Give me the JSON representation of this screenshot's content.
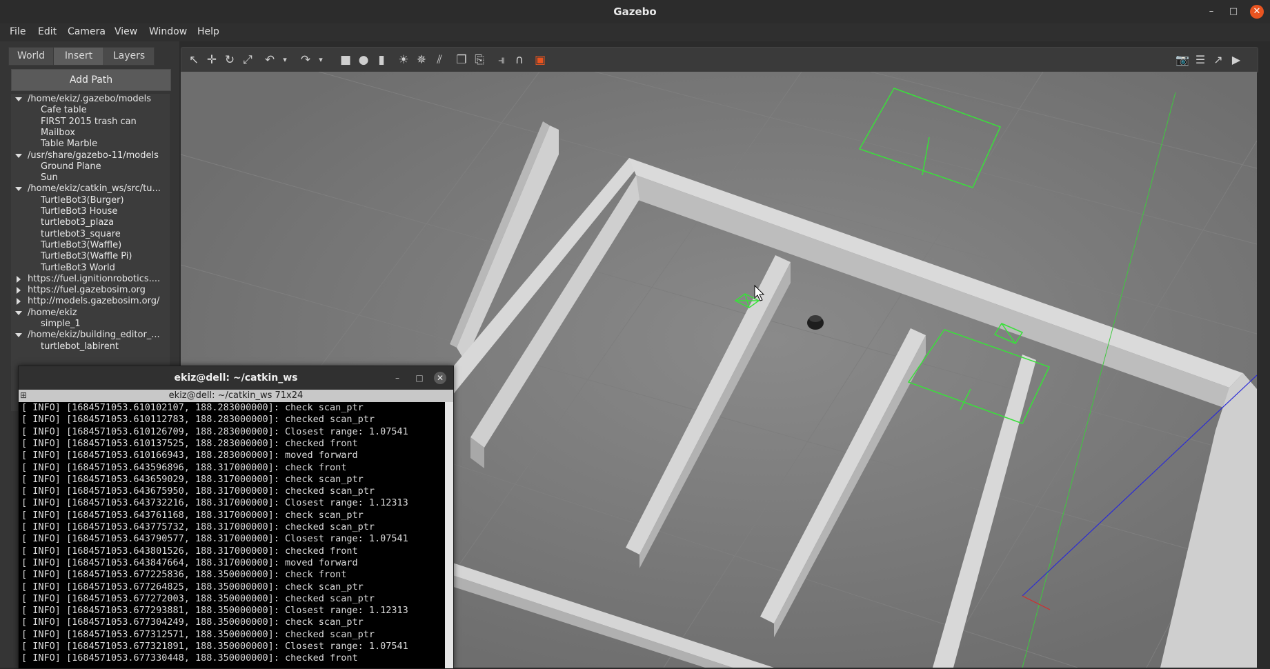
{
  "window": {
    "title": "Gazebo"
  },
  "menu": [
    "File",
    "Edit",
    "Camera",
    "View",
    "Window",
    "Help"
  ],
  "tabs": [
    "World",
    "Insert",
    "Layers"
  ],
  "insert": {
    "add_path_label": "Add Path",
    "tree": [
      {
        "label": "/home/ekiz/.gazebo/models",
        "level": 0,
        "state": "expanded"
      },
      {
        "label": "Cafe table",
        "level": 1
      },
      {
        "label": "FIRST 2015 trash can",
        "level": 1
      },
      {
        "label": "Mailbox",
        "level": 1
      },
      {
        "label": "Table Marble",
        "level": 1
      },
      {
        "label": "/usr/share/gazebo-11/models",
        "level": 0,
        "state": "expanded"
      },
      {
        "label": "Ground Plane",
        "level": 1
      },
      {
        "label": "Sun",
        "level": 1
      },
      {
        "label": "/home/ekiz/catkin_ws/src/tu...",
        "level": 0,
        "state": "expanded"
      },
      {
        "label": "TurtleBot3(Burger)",
        "level": 1
      },
      {
        "label": "TurtleBot3 House",
        "level": 1
      },
      {
        "label": "turtlebot3_plaza",
        "level": 1
      },
      {
        "label": "turtlebot3_square",
        "level": 1
      },
      {
        "label": "TurtleBot3(Waffle)",
        "level": 1
      },
      {
        "label": "TurtleBot3(Waffle Pi)",
        "level": 1
      },
      {
        "label": "TurtleBot3 World",
        "level": 1
      },
      {
        "label": "https://fuel.ignitionrobotics....",
        "level": 0,
        "state": "collapsed"
      },
      {
        "label": "https://fuel.gazebosim.org",
        "level": 0,
        "state": "collapsed"
      },
      {
        "label": "http://models.gazebosim.org/",
        "level": 0,
        "state": "collapsed"
      },
      {
        "label": "/home/ekiz",
        "level": 0,
        "state": "expanded"
      },
      {
        "label": "simple_1",
        "level": 1
      },
      {
        "label": "/home/ekiz/building_editor_...",
        "level": 0,
        "state": "expanded"
      },
      {
        "label": "turtlebot_labirent",
        "level": 1
      }
    ]
  },
  "toolbar": {
    "icons": [
      "select-mode-icon",
      "translate-icon",
      "rotate-icon",
      "scale-icon",
      "undo-icon",
      "undo-dropdown-icon",
      "redo-icon",
      "redo-dropdown-icon",
      "box-shape-icon",
      "sphere-shape-icon",
      "cylinder-shape-icon",
      "point-light-icon",
      "spot-light-icon",
      "directional-light-icon",
      "copy-icon",
      "paste-icon",
      "align-icon",
      "snap-icon",
      "view-angle-icon"
    ],
    "right_icons": [
      "screenshot-icon",
      "log-icon",
      "plot-icon",
      "record-video-icon"
    ]
  },
  "terminal": {
    "title": "ekiz@dell: ~/catkin_ws",
    "subtitle": "ekiz@dell: ~/catkin_ws 71x24",
    "lines": [
      "[ INFO] [1684571053.610102107, 188.283000000]: check scan_ptr",
      "[ INFO] [1684571053.610112783, 188.283000000]: checked scan_ptr",
      "[ INFO] [1684571053.610126709, 188.283000000]: Closest range: 1.07541",
      "[ INFO] [1684571053.610137525, 188.283000000]: checked front",
      "[ INFO] [1684571053.610166943, 188.283000000]: moved forward",
      "[ INFO] [1684571053.643596896, 188.317000000]: check front",
      "[ INFO] [1684571053.643659029, 188.317000000]: check scan_ptr",
      "[ INFO] [1684571053.643675950, 188.317000000]: checked scan_ptr",
      "[ INFO] [1684571053.643732216, 188.317000000]: Closest range: 1.12313",
      "[ INFO] [1684571053.643761168, 188.317000000]: check scan_ptr",
      "[ INFO] [1684571053.643775732, 188.317000000]: checked scan_ptr",
      "[ INFO] [1684571053.643790577, 188.317000000]: Closest range: 1.07541",
      "[ INFO] [1684571053.643801526, 188.317000000]: checked front",
      "[ INFO] [1684571053.643847664, 188.317000000]: moved forward",
      "[ INFO] [1684571053.677225836, 188.350000000]: check front",
      "[ INFO] [1684571053.677264825, 188.350000000]: check scan_ptr",
      "[ INFO] [1684571053.677272003, 188.350000000]: checked scan_ptr",
      "[ INFO] [1684571053.677293881, 188.350000000]: Closest range: 1.12313",
      "[ INFO] [1684571053.677304249, 188.350000000]: check scan_ptr",
      "[ INFO] [1684571053.677312571, 188.350000000]: checked scan_ptr",
      "[ INFO] [1684571053.677321891, 188.350000000]: Closest range: 1.07541",
      "[ INFO] [1684571053.677330448, 188.350000000]: checked front"
    ]
  },
  "colors": {
    "accent": "#e95420",
    "selection_green": "#39e03a",
    "axis_blue": "#2b2bd6"
  }
}
